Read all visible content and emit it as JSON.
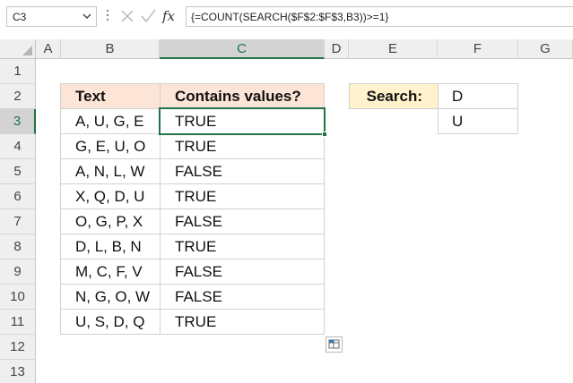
{
  "formula_bar": {
    "name_box": "C3",
    "dropdown_icon": "chevron-down-icon",
    "cancel_icon": "close-icon",
    "enter_icon": "check-icon",
    "function_icon": "fx-icon",
    "fx_label": "fx",
    "formula": "{=COUNT(SEARCH($F$2:$F$3,B3))>=1}"
  },
  "columns": [
    "A",
    "B",
    "C",
    "D",
    "E",
    "F",
    "G"
  ],
  "active_column": "C",
  "rows": [
    "1",
    "2",
    "3",
    "4",
    "5",
    "6",
    "7",
    "8",
    "9",
    "10",
    "11",
    "12",
    "13"
  ],
  "active_row": "3",
  "table": {
    "headers": [
      "Text",
      "Contains values?"
    ],
    "rows": [
      [
        "A, U, G, E",
        "TRUE"
      ],
      [
        "G, E, U, O",
        "TRUE"
      ],
      [
        "A, N, L, W",
        "FALSE"
      ],
      [
        "X, Q, D, U",
        "TRUE"
      ],
      [
        "O, G, P, X",
        "FALSE"
      ],
      [
        "D, L, B, N",
        "TRUE"
      ],
      [
        "M, C, F, V",
        "FALSE"
      ],
      [
        "N, G, O, W",
        "FALSE"
      ],
      [
        "U, S, D, Q",
        "TRUE"
      ]
    ]
  },
  "search": {
    "label": "Search:",
    "values": [
      "D",
      "U"
    ]
  },
  "colors": {
    "accent": "#217346",
    "header_fill": "#fce4d6",
    "search_fill": "#fff2cc"
  }
}
